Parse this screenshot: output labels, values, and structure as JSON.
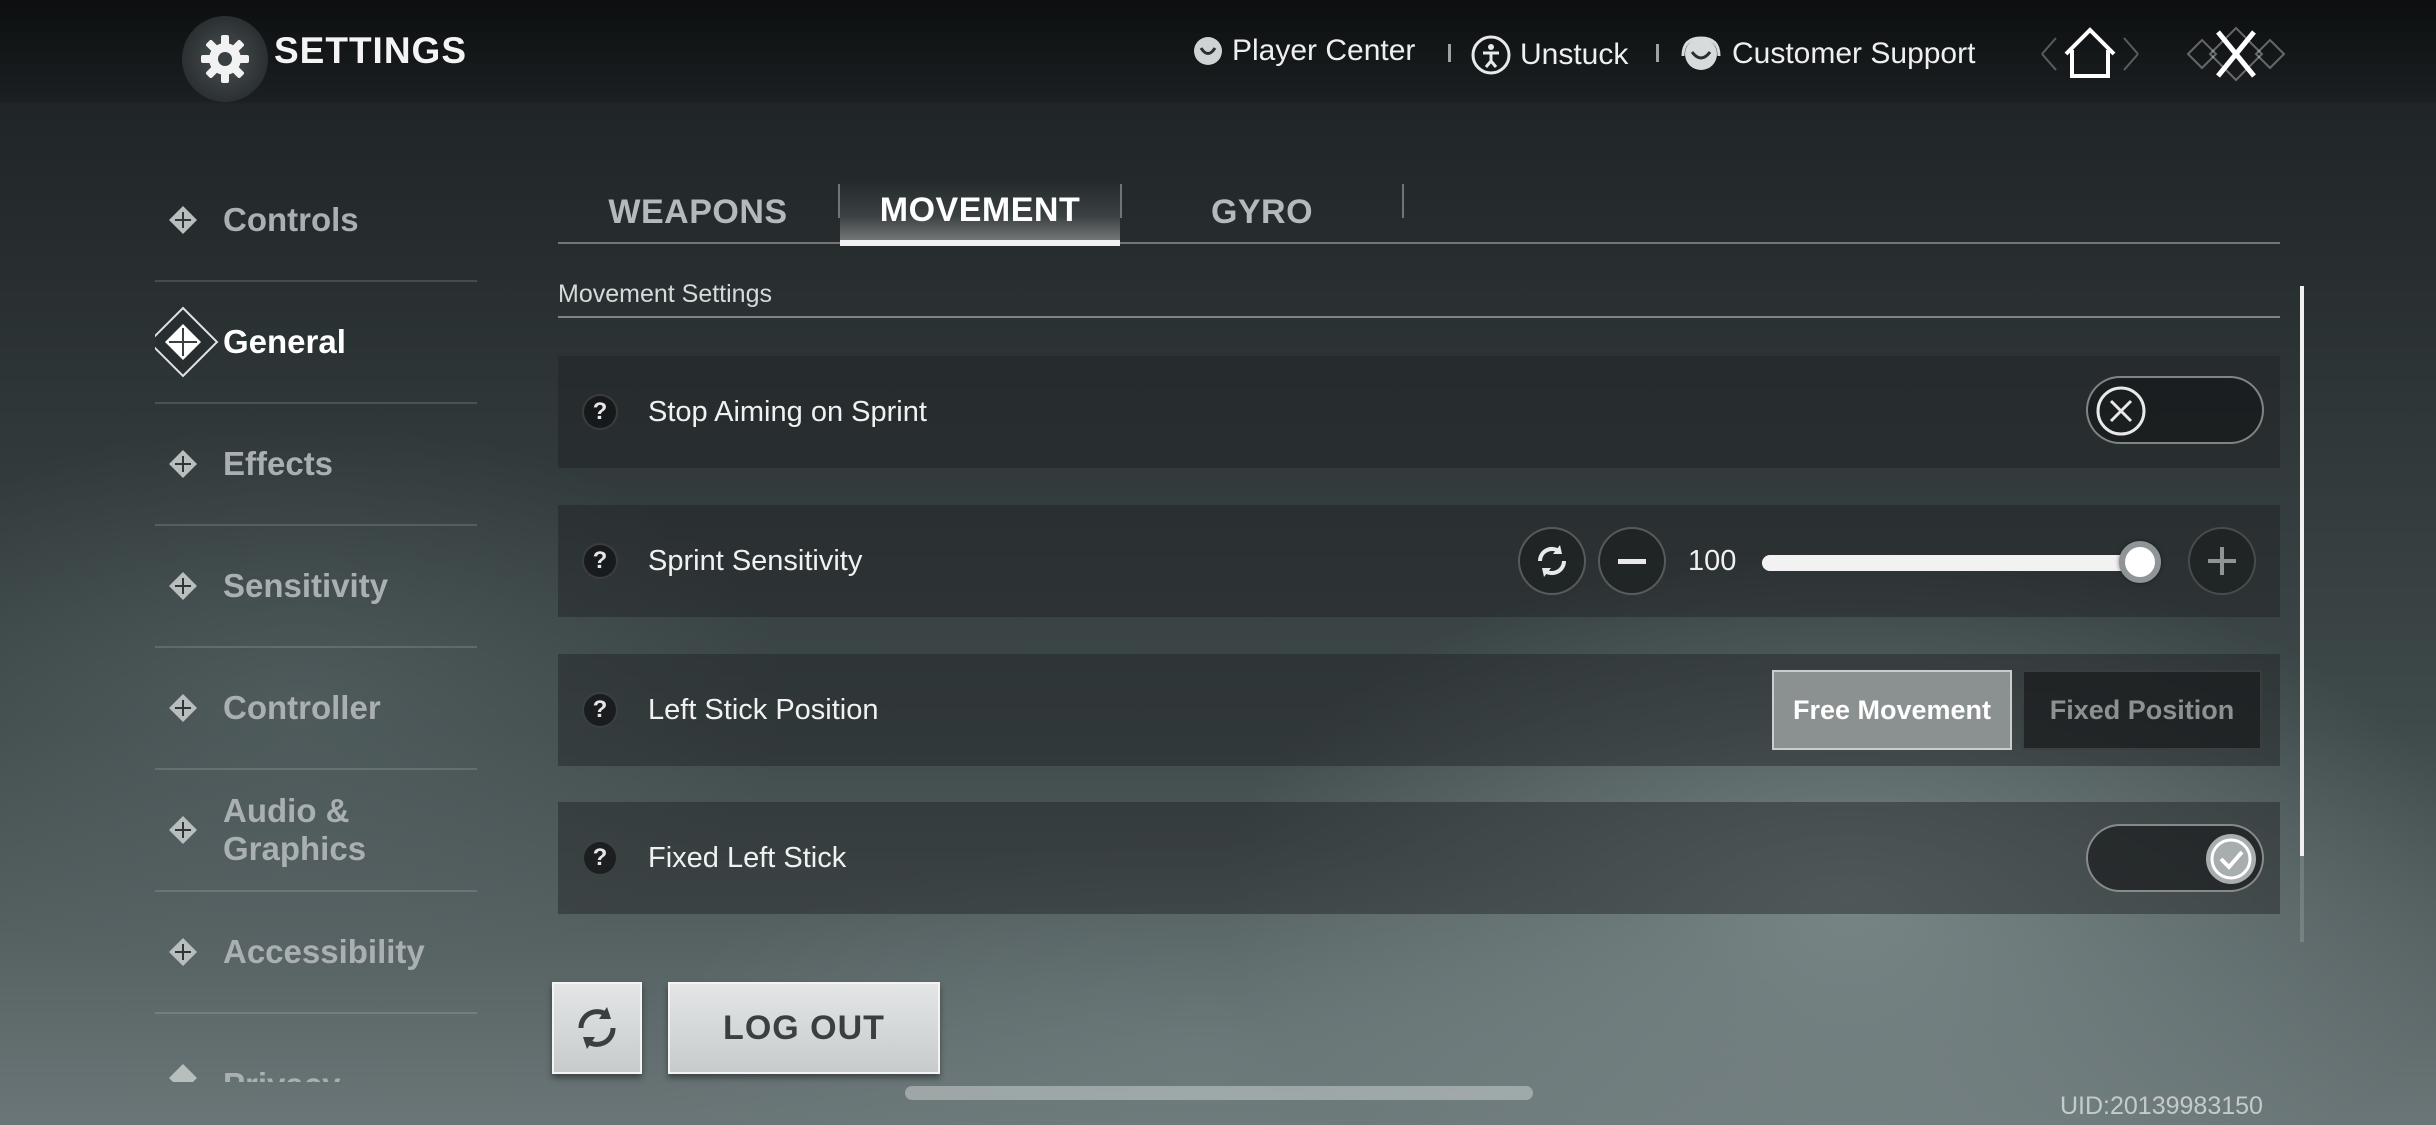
{
  "header": {
    "title": "SETTINGS",
    "nav": [
      {
        "label": "Player Center",
        "icon": "player-center-icon"
      },
      {
        "label": "Unstuck",
        "icon": "unstuck-icon"
      },
      {
        "label": "Customer Support",
        "icon": "customer-support-icon"
      }
    ],
    "home_icon": "home-icon",
    "close_icon": "close-icon"
  },
  "sidebar": {
    "items": [
      {
        "label": "Controls",
        "active": false
      },
      {
        "label": "General",
        "active": true
      },
      {
        "label": "Effects",
        "active": false
      },
      {
        "label": "Sensitivity",
        "active": false
      },
      {
        "label": "Controller",
        "active": false
      },
      {
        "label": "Audio & Graphics",
        "active": false
      },
      {
        "label": "Accessibility",
        "active": false
      },
      {
        "label": "Privacy Settings",
        "active": false
      }
    ]
  },
  "tabs": [
    {
      "label": "WEAPONS",
      "active": false
    },
    {
      "label": "MOVEMENT",
      "active": true
    },
    {
      "label": "GYRO",
      "active": false
    }
  ],
  "section": {
    "title": "Movement Settings"
  },
  "settings": {
    "stop_aiming": {
      "label": "Stop Aiming on Sprint",
      "enabled": false
    },
    "sprint_sensitivity": {
      "label": "Sprint Sensitivity",
      "value": "100",
      "fraction": 1.0
    },
    "left_stick_position": {
      "label": "Left Stick Position",
      "options": [
        "Free Movement",
        "Fixed Position"
      ],
      "selected": "Free Movement"
    },
    "fixed_left_stick": {
      "label": "Fixed Left Stick",
      "enabled": true
    }
  },
  "footer": {
    "logout_label": "LOG OUT",
    "uid": "UID:20139983150"
  },
  "colors": {
    "accent": "#f2f2f2",
    "segment_active": "#8b9191"
  }
}
